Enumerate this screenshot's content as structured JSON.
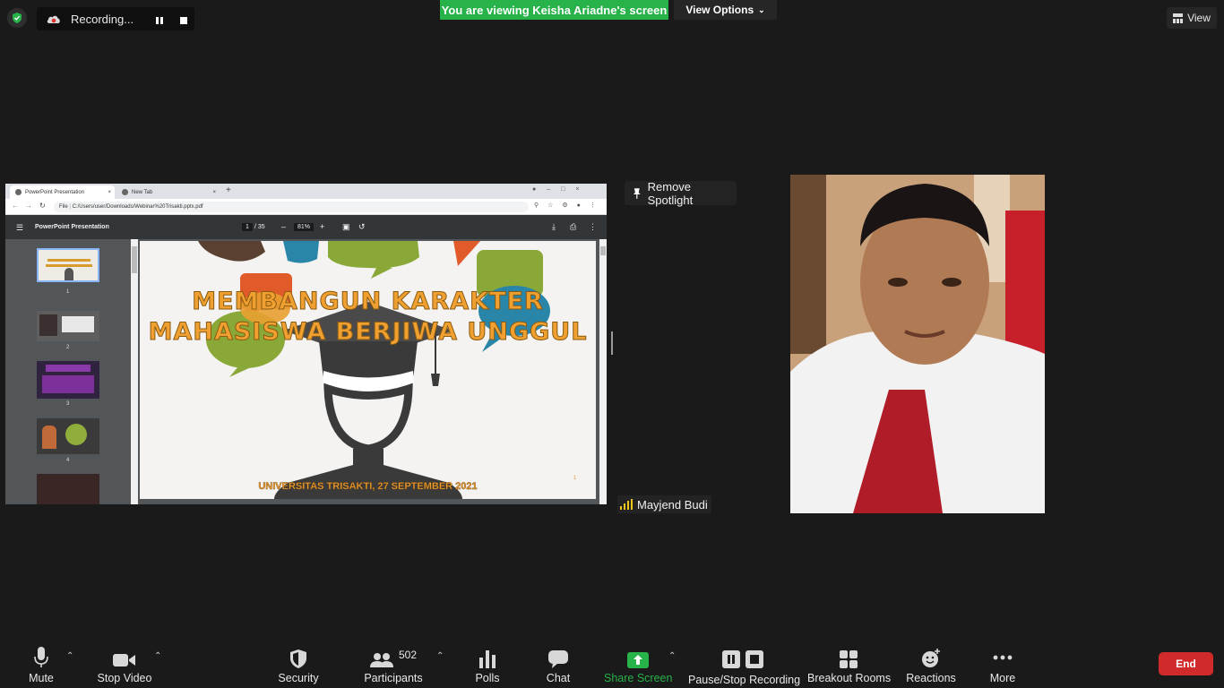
{
  "top": {
    "recording_label": "Recording...",
    "viewing_banner": "You are viewing Keisha Ariadne's screen",
    "view_options_label": "View Options",
    "view_label": "View"
  },
  "shared_screen": {
    "browser_tabs": [
      "PowerPoint Presentation",
      "New Tab"
    ],
    "url": "C:/Users/user/Downloads/Webinar%20Trisakti.pptx.pdf",
    "url_prefix": "File",
    "pdf_title": "PowerPoint Presentation",
    "page_current": "1",
    "page_total": "/ 35",
    "zoom": "81%",
    "thumbnail_numbers": [
      "1",
      "2",
      "3",
      "4"
    ],
    "slide_title_line1": "MEMBANGUN KARAKTER",
    "slide_title_line2": "MAHASISWA BERJIWA UNGGUL",
    "slide_footer": "UNIVERSITAS TRISAKTI, 27 SEPTEMBER 2021",
    "slide_page_mark": "1"
  },
  "spotlight": {
    "remove_label": "Remove Spotlight",
    "participant_name": "Mayjend Budi"
  },
  "toolbar": {
    "mute": "Mute",
    "stop_video": "Stop Video",
    "security": "Security",
    "participants": "Participants",
    "participant_count": "502",
    "polls": "Polls",
    "chat": "Chat",
    "share_screen": "Share Screen",
    "pause_stop_recording": "Pause/Stop Recording",
    "breakout_rooms": "Breakout Rooms",
    "reactions": "Reactions",
    "more": "More",
    "end": "End"
  },
  "colors": {
    "banner_green": "#27b24a",
    "share_green": "#27b24a",
    "end_red": "#d12a2a",
    "background": "#1a1a1a"
  }
}
